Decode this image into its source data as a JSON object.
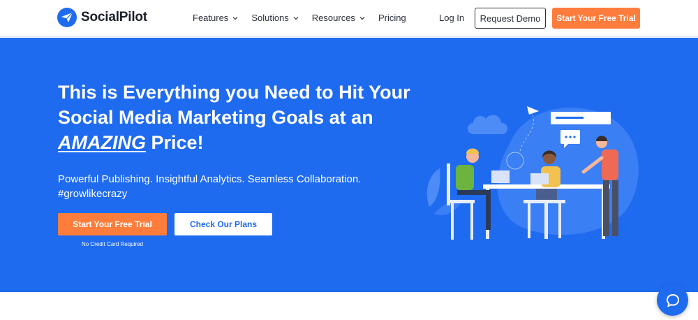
{
  "brand": {
    "name": "SocialPilot"
  },
  "nav": {
    "items": [
      {
        "label": "Features",
        "has_dropdown": true
      },
      {
        "label": "Solutions",
        "has_dropdown": true
      },
      {
        "label": "Resources",
        "has_dropdown": true
      },
      {
        "label": "Pricing",
        "has_dropdown": false
      }
    ],
    "login_label": "Log In",
    "demo_label": "Request Demo",
    "trial_label": "Start Your Free Trial"
  },
  "hero": {
    "title_part1": "This is Everything you Need to Hit Your Social Media Marketing Goals at an ",
    "title_emphasis": "AMAZING",
    "title_part2": " Price!",
    "subtitle_line1": "Powerful Publishing. Insightful Analytics. Seamless Collaboration.",
    "subtitle_line2": "#growlikecrazy",
    "primary_cta": "Start Your Free Trial",
    "secondary_cta": "Check Our Plans",
    "cta_note": "No Credit Card Required"
  },
  "colors": {
    "brand_blue": "#1f6bf0",
    "accent_orange": "#ff7d3c",
    "text_dark": "#2b2f3a"
  },
  "icons": {
    "logo": "paper-plane-icon",
    "chat": "chat-bubble-icon",
    "dropdown": "chevron-down-icon"
  }
}
